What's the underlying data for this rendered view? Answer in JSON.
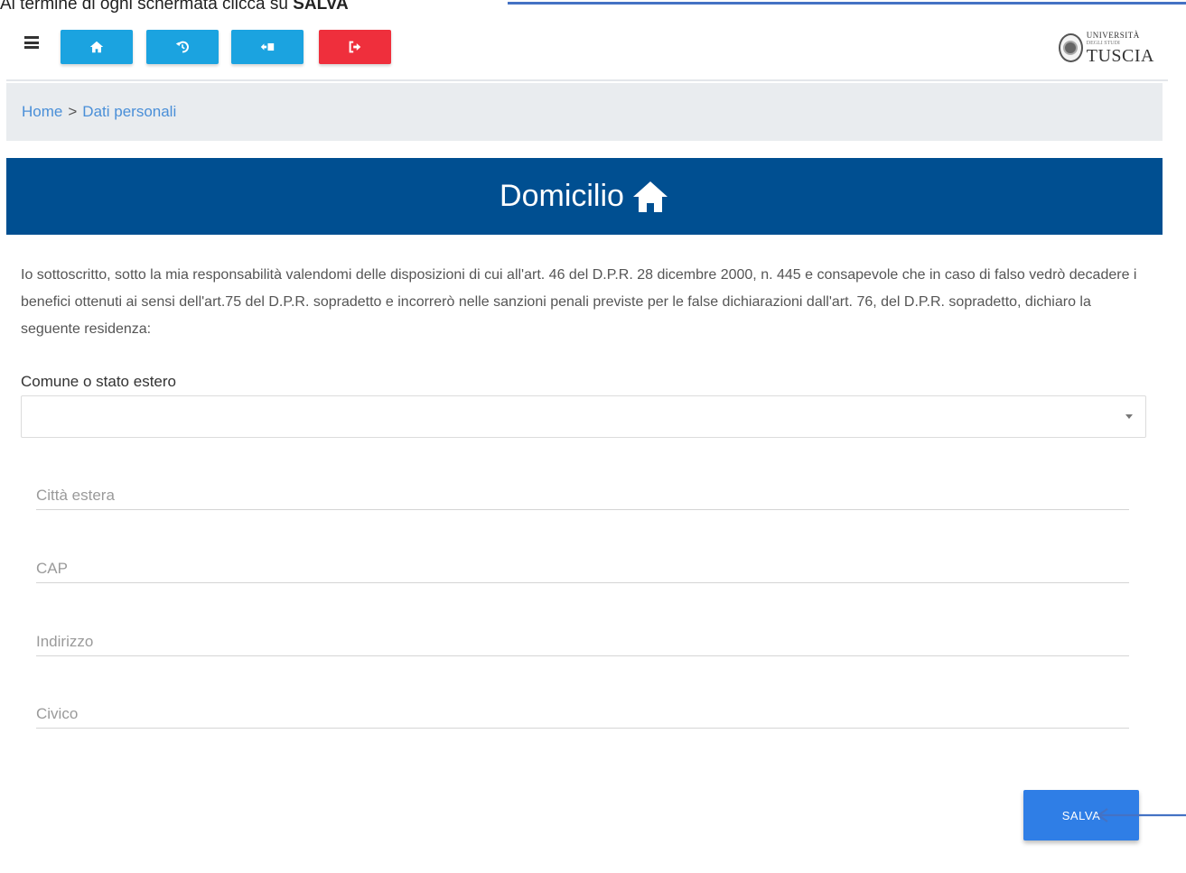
{
  "annotation": {
    "text": "Al termine di ogni schermata clicca su ",
    "bold": "SALVA"
  },
  "toolbar": {
    "menu_icon": "hamburger-menu-icon",
    "buttons": [
      {
        "icon": "home-icon",
        "color": "#1ba3e0"
      },
      {
        "icon": "undo-icon",
        "color": "#1ba3e0"
      },
      {
        "icon": "switch-icon",
        "color": "#1ba3e0"
      },
      {
        "icon": "logout-icon",
        "color": "#ef2f3c"
      }
    ],
    "logo": {
      "line1": "UNIVERSITÀ",
      "line2": "DEGLI STUDI",
      "line3": "TUSCIA"
    }
  },
  "breadcrumb": {
    "home": "Home",
    "separator": ">",
    "current": "Dati personali"
  },
  "header": {
    "title": "Domicilio",
    "icon": "home-icon",
    "background": "#004f91"
  },
  "intro_text": "Io sottoscritto, sotto la mia responsabilità valendomi delle disposizioni di cui all'art. 46 del D.P.R. 28 dicembre 2000, n. 445 e consapevole che in caso di falso vedrò decadere i benefici ottenuti ai sensi dell'art.75 del D.P.R. sopradetto e incorrerò nelle sanzioni penali previste per le false dichiarazioni dall'art. 76, del D.P.R. sopradetto, dichiaro la seguente residenza:",
  "form": {
    "comune_label": "Comune o stato estero",
    "comune_value": "",
    "citta_placeholder": "Città estera",
    "cap_placeholder": "CAP",
    "indirizzo_placeholder": "Indirizzo",
    "civico_placeholder": "Civico",
    "save_label": "SALVA"
  },
  "colors": {
    "accent_blue": "#1ba3e0",
    "danger_red": "#ef2f3c",
    "save_blue": "#2f7ee6",
    "link_blue": "#4a8fd8"
  }
}
